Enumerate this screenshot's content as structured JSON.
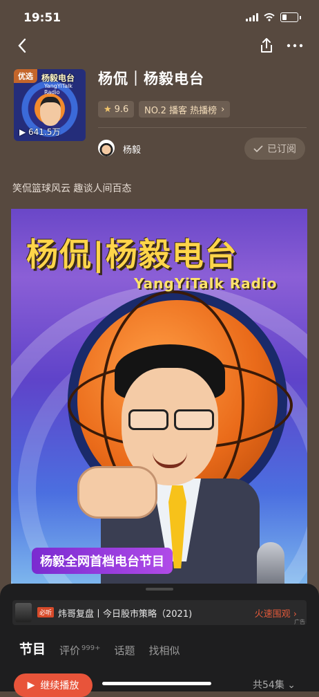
{
  "status_bar": {
    "time": "19:51"
  },
  "header": {
    "cover_badge": "优选",
    "cover_title": "杨毅电台",
    "cover_subtitle": "YangYiTalk Radio",
    "cover_plays": "641.5万",
    "title": "杨侃｜杨毅电台",
    "rating": "9.6",
    "rank": "NO.2 播客 热播榜",
    "author": "杨毅",
    "subscribe_label": "已订阅",
    "description": "笑侃篮球风云 趣谈人间百态"
  },
  "cover_art": {
    "title": "杨侃|杨毅电台",
    "subtitle": "YangYiTalk Radio",
    "banner": "杨毅全网首档电台节目"
  },
  "ad": {
    "tag": "必听",
    "text": "炜哥复盘丨今日股市策略（2021)",
    "cta": "火速围观",
    "label": "广告"
  },
  "tabs": [
    {
      "label": "节目"
    },
    {
      "label": "评价",
      "badge": "999+"
    },
    {
      "label": "话题"
    },
    {
      "label": "找相似"
    }
  ],
  "bottom": {
    "play_label": "继续播放",
    "episode_count": "共54集"
  },
  "colors": {
    "background": "#57493f",
    "accent": "#e8543a",
    "gold": "#f3dcb9"
  }
}
